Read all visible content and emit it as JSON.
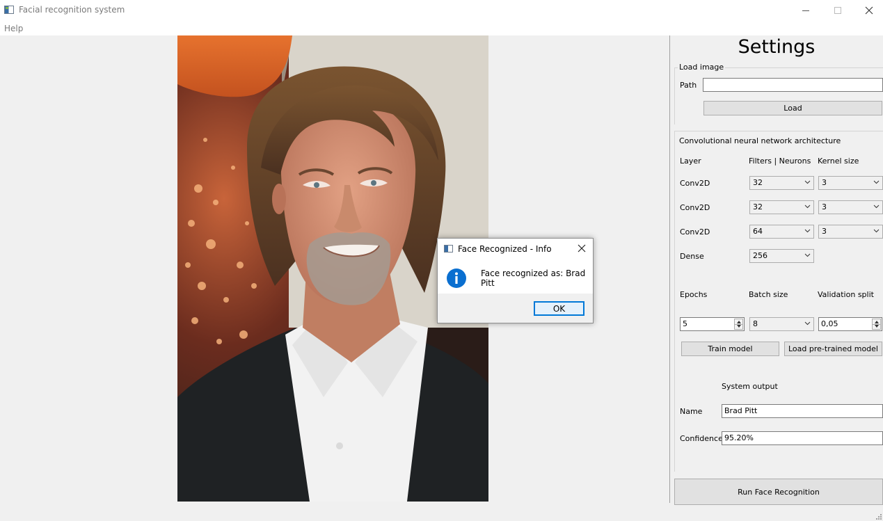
{
  "window": {
    "title": "Facial recognition system",
    "icon": "app-window-icon"
  },
  "menu": {
    "items": [
      "Help"
    ]
  },
  "image": {
    "description_icon": "portrait-photo"
  },
  "settings": {
    "title": "Settings",
    "load_image": {
      "group_title": "Load image",
      "path_label": "Path",
      "path_value": "",
      "load_button": "Load"
    },
    "cnn": {
      "group_title": "Convolutional neural network architecture",
      "headers": {
        "layer": "Layer",
        "filters": "Filters | Neurons",
        "kernel": "Kernel size"
      },
      "layers": [
        {
          "name": "Conv2D",
          "filters": "32",
          "kernel": "3"
        },
        {
          "name": "Conv2D",
          "filters": "32",
          "kernel": "3"
        },
        {
          "name": "Conv2D",
          "filters": "64",
          "kernel": "3"
        },
        {
          "name": "Dense",
          "filters": "256",
          "kernel": ""
        }
      ],
      "training": {
        "epochs_label": "Epochs",
        "batch_label": "Batch size",
        "validation_label": "Validation split",
        "epochs_value": "5",
        "batch_value": "8",
        "validation_value": "0,05"
      },
      "train_button": "Train model",
      "load_pretrained_button": "Load pre-trained model"
    },
    "output": {
      "title": "System output",
      "name_label": "Name",
      "name_value": "Brad Pitt",
      "confidence_label": "Confidence",
      "confidence_value": "95.20%"
    },
    "run_button": "Run Face Recognition"
  },
  "dialog": {
    "title": "Face Recognized - Info",
    "message": "Face recognized as: Brad Pitt",
    "ok_button": "OK"
  },
  "colors": {
    "accent": "#0078d7",
    "info_icon": "#0a6fd0",
    "background": "#f0f0f0"
  }
}
